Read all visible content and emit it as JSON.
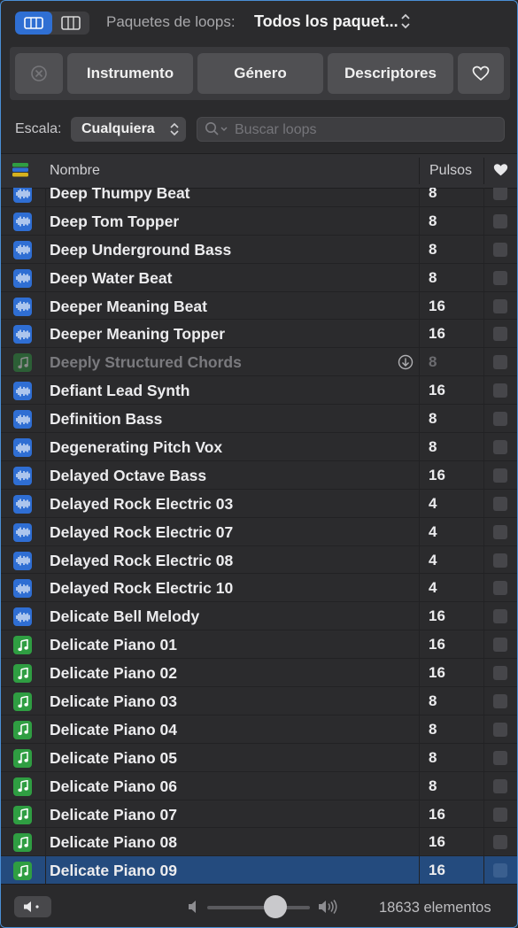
{
  "header": {
    "view_buttons": [
      {
        "icon": "single-column-icon",
        "active": true
      },
      {
        "icon": "columns-icon",
        "active": false
      }
    ],
    "pack_label": "Paquetes de loops:",
    "pack_value": "Todos los paquet..."
  },
  "filters": {
    "reset_icon": "reset-icon",
    "buttons": [
      "Instrumento",
      "Género",
      "Descriptores"
    ],
    "favorites_icon": "heart-icon"
  },
  "scale": {
    "label": "Escala:",
    "value": "Cualquiera"
  },
  "search": {
    "placeholder": "Buscar loops",
    "value": ""
  },
  "table": {
    "columns": {
      "name": "Nombre",
      "beats": "Pulsos"
    },
    "rows": [
      {
        "name": "Deep Thumpy Beat",
        "beats": "8",
        "type": "audio"
      },
      {
        "name": "Deep Tom Topper",
        "beats": "8",
        "type": "audio"
      },
      {
        "name": "Deep Underground Bass",
        "beats": "8",
        "type": "audio"
      },
      {
        "name": "Deep Water Beat",
        "beats": "8",
        "type": "audio"
      },
      {
        "name": "Deeper Meaning Beat",
        "beats": "16",
        "type": "audio"
      },
      {
        "name": "Deeper Meaning Topper",
        "beats": "16",
        "type": "audio"
      },
      {
        "name": "Deeply Structured Chords",
        "beats": "8",
        "type": "midi",
        "dim": true,
        "download": true
      },
      {
        "name": "Defiant Lead Synth",
        "beats": "16",
        "type": "audio"
      },
      {
        "name": "Definition Bass",
        "beats": "8",
        "type": "audio"
      },
      {
        "name": "Degenerating Pitch Vox",
        "beats": "8",
        "type": "audio"
      },
      {
        "name": "Delayed Octave Bass",
        "beats": "16",
        "type": "audio"
      },
      {
        "name": "Delayed Rock Electric 03",
        "beats": "4",
        "type": "audio"
      },
      {
        "name": "Delayed Rock Electric 07",
        "beats": "4",
        "type": "audio"
      },
      {
        "name": "Delayed Rock Electric 08",
        "beats": "4",
        "type": "audio"
      },
      {
        "name": "Delayed Rock Electric 10",
        "beats": "4",
        "type": "audio"
      },
      {
        "name": "Delicate Bell Melody",
        "beats": "16",
        "type": "audio"
      },
      {
        "name": "Delicate Piano 01",
        "beats": "16",
        "type": "midi"
      },
      {
        "name": "Delicate Piano 02",
        "beats": "16",
        "type": "midi"
      },
      {
        "name": "Delicate Piano 03",
        "beats": "8",
        "type": "midi"
      },
      {
        "name": "Delicate Piano 04",
        "beats": "8",
        "type": "midi"
      },
      {
        "name": "Delicate Piano 05",
        "beats": "8",
        "type": "midi"
      },
      {
        "name": "Delicate Piano 06",
        "beats": "8",
        "type": "midi"
      },
      {
        "name": "Delicate Piano 07",
        "beats": "16",
        "type": "midi"
      },
      {
        "name": "Delicate Piano 08",
        "beats": "16",
        "type": "midi"
      },
      {
        "name": "Delicate Piano 09",
        "beats": "16",
        "type": "midi",
        "selected": true
      }
    ]
  },
  "footer": {
    "volume_level": 0.66,
    "count_text": "18633 elementos"
  },
  "colors": {
    "accent": "#2f6fd3",
    "audio_icon": "#2f6ed3",
    "midi_icon": "#2f9e42",
    "selected_row": "#244b7e"
  }
}
